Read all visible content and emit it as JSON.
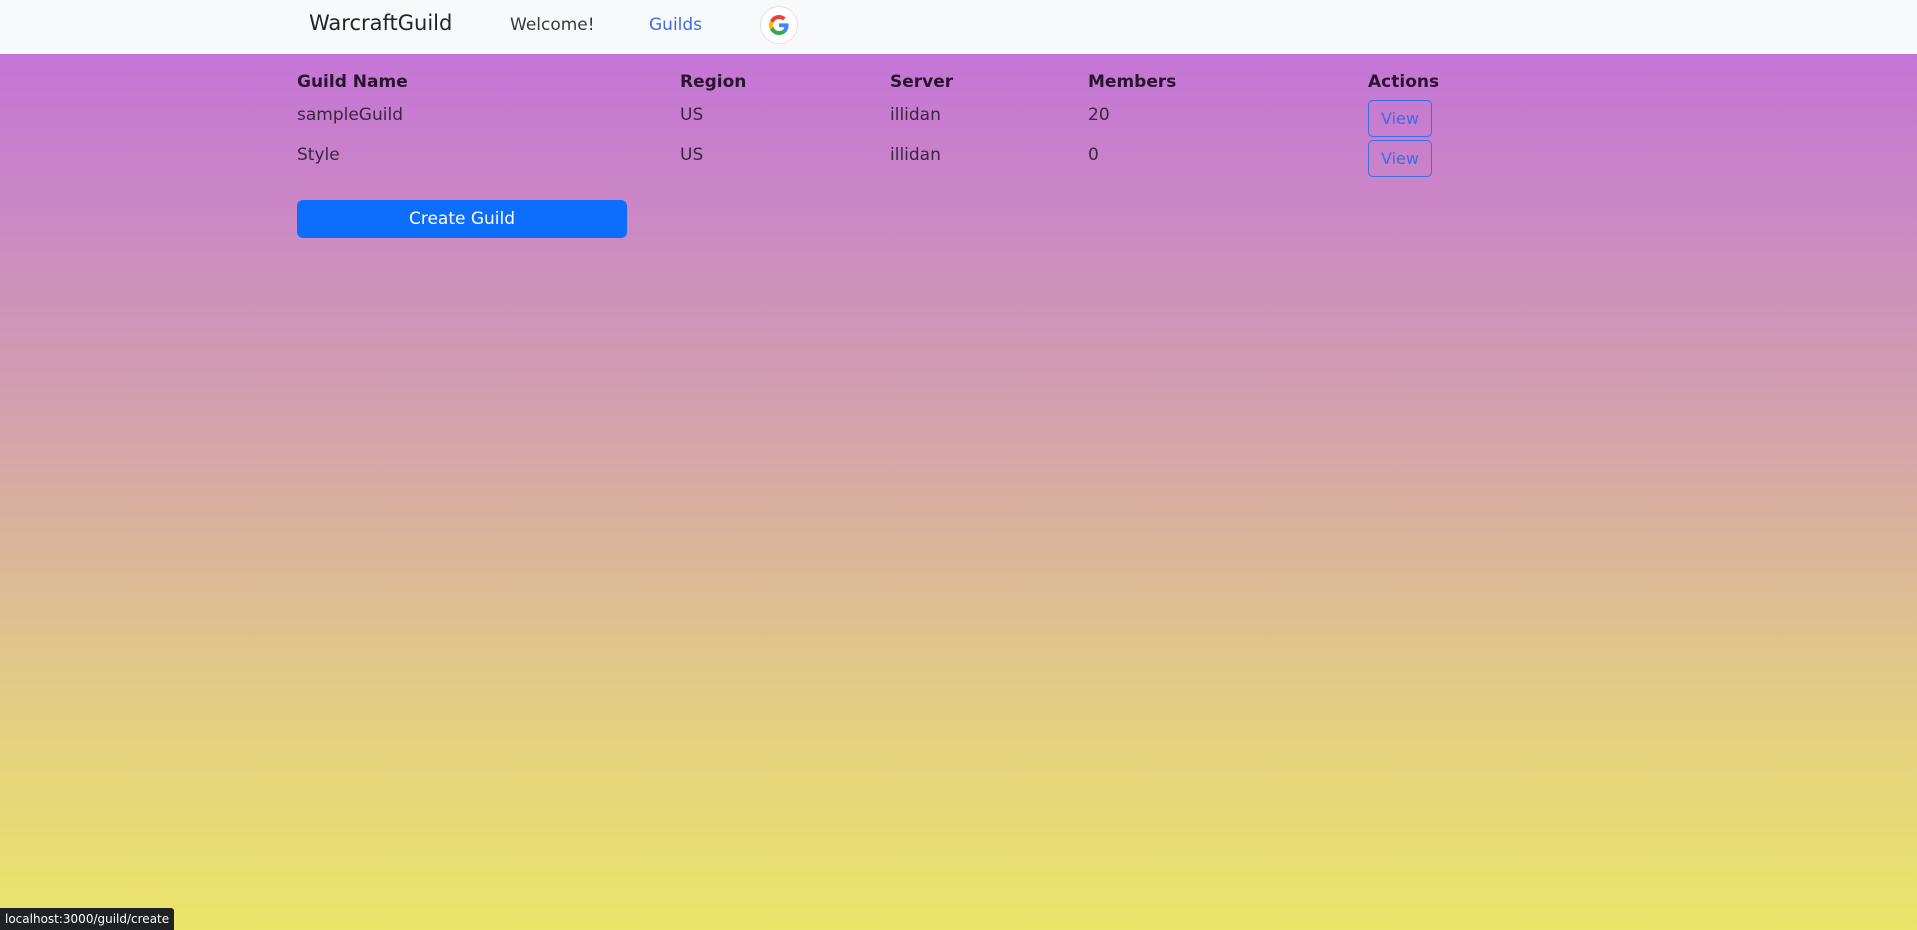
{
  "navbar": {
    "brand": "WarcraftGuild",
    "links": [
      {
        "label": "Welcome!"
      },
      {
        "label": "Guilds"
      }
    ],
    "google_icon": "google-g-icon"
  },
  "table": {
    "headers": [
      "Guild Name",
      "Region",
      "Server",
      "Members",
      "Actions"
    ],
    "rows": [
      {
        "name": "sampleGuild",
        "region": "US",
        "server": "illidan",
        "members": "20",
        "action": "View"
      },
      {
        "name": "Style",
        "region": "US",
        "server": "illidan",
        "members": "0",
        "action": "View"
      }
    ]
  },
  "create_button": {
    "label": "Create Guild"
  },
  "status_bar": {
    "url": "localhost:3000/guild/create"
  },
  "colors": {
    "primary": "#0d6efd",
    "link": "#3d6de0",
    "navbar_bg": "#f8f9fa",
    "gradient_top": "#c26edd",
    "gradient_bottom": "#ebe56a"
  }
}
